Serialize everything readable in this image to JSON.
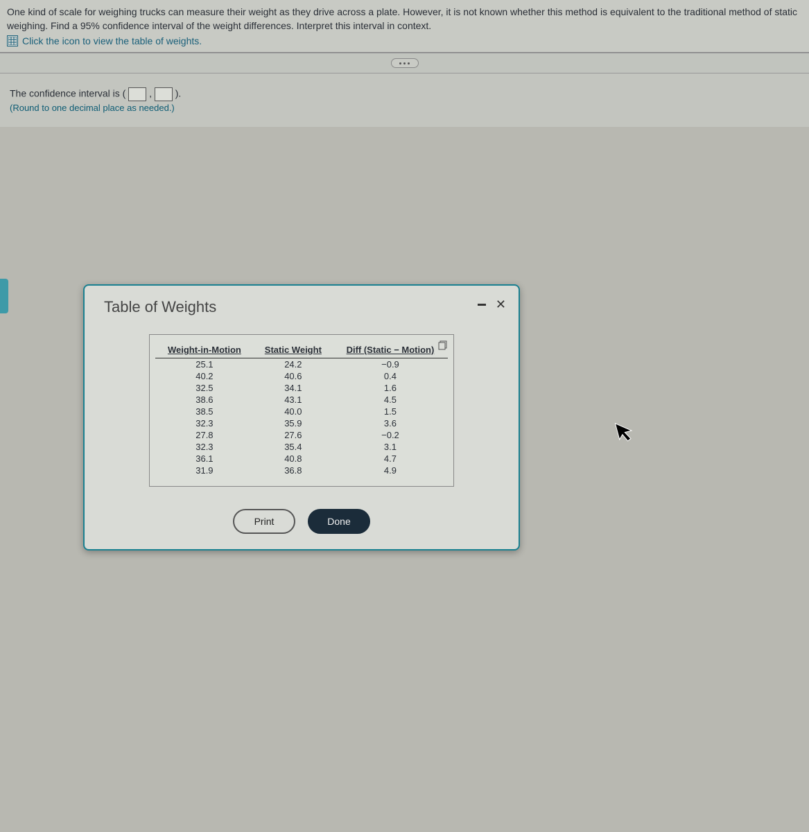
{
  "question": {
    "text": "One kind of scale for weighing trucks can measure their weight as they drive across a plate. However, it is not known whether this method is equivalent to the traditional method of static weighing. Find a 95% confidence interval of the weight differences. Interpret this interval in context.",
    "link_text": "Click the icon to view the table of weights."
  },
  "answer": {
    "prefix": "The confidence interval is (",
    "comma": ",",
    "suffix": ").",
    "hint": "(Round to one decimal place as needed.)"
  },
  "modal": {
    "title": "Table of Weights",
    "headers": [
      "Weight-in-Motion",
      "Static Weight",
      "Diff (Static − Motion)"
    ],
    "rows": [
      [
        "25.1",
        "24.2",
        "−0.9"
      ],
      [
        "40.2",
        "40.6",
        "0.4"
      ],
      [
        "32.5",
        "34.1",
        "1.6"
      ],
      [
        "38.6",
        "43.1",
        "4.5"
      ],
      [
        "38.5",
        "40.0",
        "1.5"
      ],
      [
        "32.3",
        "35.9",
        "3.6"
      ],
      [
        "27.8",
        "27.6",
        "−0.2"
      ],
      [
        "32.3",
        "35.4",
        "3.1"
      ],
      [
        "36.1",
        "40.8",
        "4.7"
      ],
      [
        "31.9",
        "36.8",
        "4.9"
      ]
    ],
    "print_label": "Print",
    "done_label": "Done"
  }
}
